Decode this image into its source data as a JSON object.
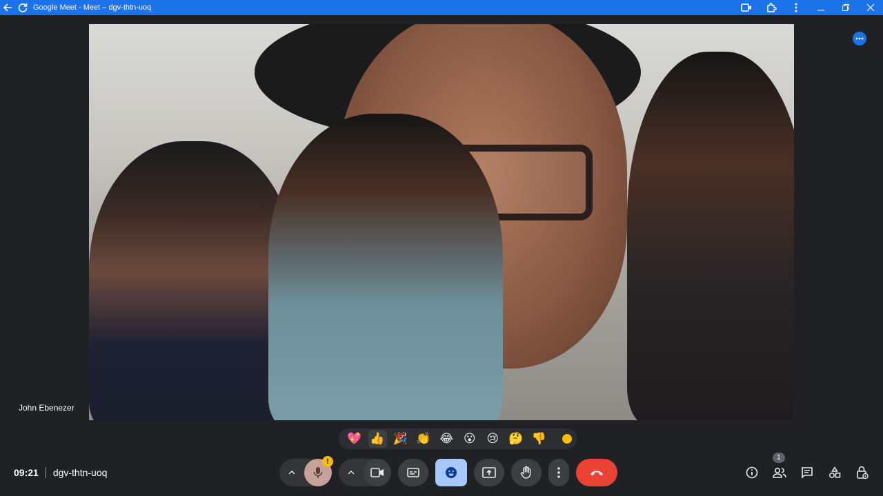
{
  "window": {
    "title": "Google Meet - Meet – dgv-thtn-uoq",
    "accent": "#1a73e8"
  },
  "tile": {
    "participant_name": "John Ebenezer"
  },
  "reactions": [
    "💖",
    "👍",
    "🎉",
    "👏",
    "😂",
    "😮",
    "😢",
    "🤔",
    "👎"
  ],
  "meeting": {
    "time": "09:21",
    "code": "dgv-thtn-uoq"
  },
  "controls": {
    "mic_warning": "!",
    "participants_count": "1",
    "leave_color": "#ea4335"
  },
  "icons": {
    "titlebar": [
      "back-arrow-icon",
      "reload-icon",
      "video-icon",
      "extension-icon",
      "kebab-icon",
      "minimize-icon",
      "restore-icon",
      "close-icon"
    ],
    "bottom": [
      "chevron-up-icon",
      "mic-icon",
      "chevron-up-icon",
      "camera-icon",
      "captions-icon",
      "emoji-icon",
      "present-icon",
      "raise-hand-icon",
      "more-vert-icon",
      "end-call-icon",
      "info-icon",
      "people-icon",
      "chat-icon",
      "activities-icon",
      "host-controls-icon"
    ]
  }
}
